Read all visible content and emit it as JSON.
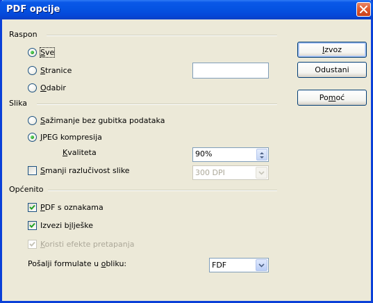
{
  "window": {
    "title": "PDF opcije"
  },
  "range": {
    "group_label": "Raspon",
    "all": {
      "label_u": "S",
      "label_rest": "ve",
      "checked": true
    },
    "pages": {
      "label_u": "S",
      "label_rest": "tranice",
      "value": ""
    },
    "selection": {
      "label_u": "O",
      "label_rest": "dabir"
    }
  },
  "image": {
    "group_label": "Slika",
    "lossless": {
      "label_u": "S",
      "label_rest": "ažimanje bez gubitka podataka"
    },
    "jpeg": {
      "label_u": "J",
      "label_rest": "PEG kompresija",
      "checked": true
    },
    "quality": {
      "label_u": "K",
      "label_rest": "valiteta",
      "value": "90%"
    },
    "reduce": {
      "label_u": "S",
      "label_rest": "manji razlučivost slike",
      "checked": false
    },
    "dpi": {
      "value": "300 DPI"
    }
  },
  "general": {
    "group_label": "Općenito",
    "tagged": {
      "label_u": "P",
      "label_rest": "DF s oznakama",
      "checked": true
    },
    "notes": {
      "label_pre": "Izvezi b",
      "label_u": "i",
      "label_rest": "lješke",
      "checked": true
    },
    "transitions": {
      "label_u": "K",
      "label_rest": "oristi efekte pretapanja",
      "checked": true
    },
    "formulas": {
      "label_pre": "Pošalji formulate u ",
      "label_u": "o",
      "label_rest": "bliku:",
      "value": "FDF"
    }
  },
  "buttons": {
    "export": {
      "label_u": "I",
      "label_rest": "zvoz"
    },
    "cancel": {
      "label": "Odustani"
    },
    "help": {
      "label_pre": "Po",
      "label_u": "m",
      "label_rest": "oć"
    }
  },
  "colors": {
    "titlebar": "#0553e2",
    "dialog_bg": "#ece9d8",
    "close_button": "#e05a2e",
    "radio_dot": "#21a121",
    "checkmark": "#21a121"
  },
  "icons": {
    "close": "close-icon",
    "check": "checkmark-icon",
    "dropdown": "chevron-down-icon",
    "spin": "spin-arrows-icon"
  }
}
